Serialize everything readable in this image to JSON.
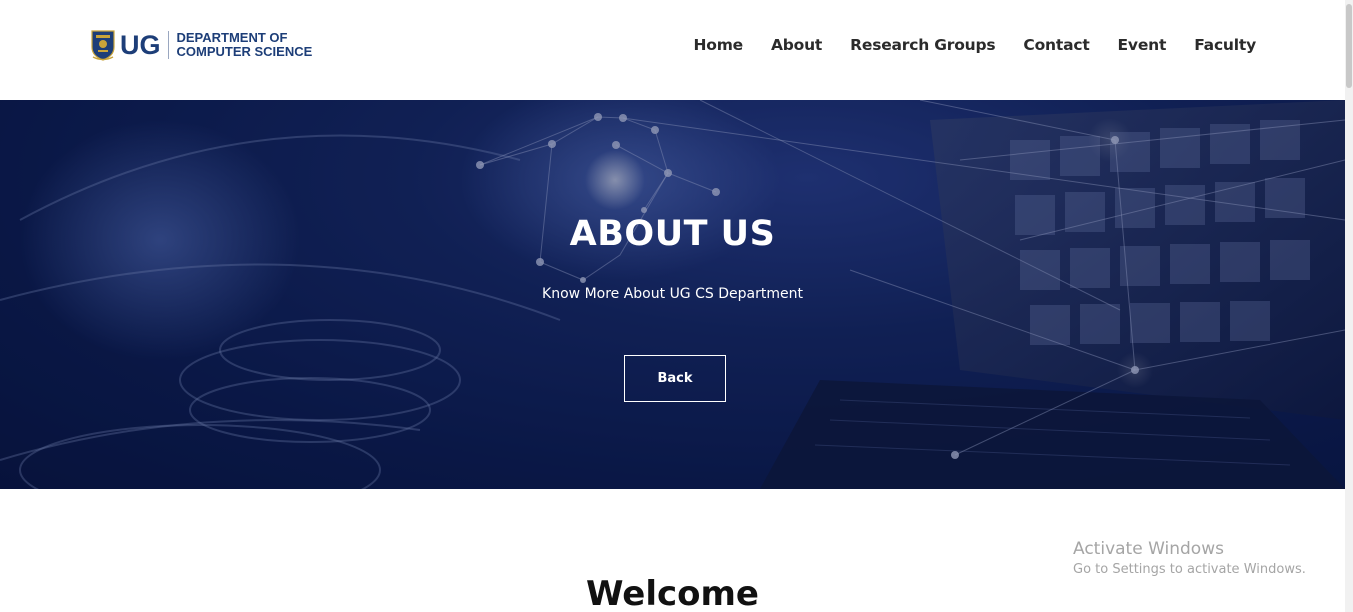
{
  "header": {
    "logo": {
      "abbr": "UG",
      "line1": "DEPARTMENT OF",
      "line2": "COMPUTER SCIENCE"
    },
    "nav": [
      {
        "label": "Home",
        "icon": null
      },
      {
        "label": "About"
      },
      {
        "label": "Research Groups"
      },
      {
        "label": "Contact"
      },
      {
        "label": "Event"
      },
      {
        "label": "Faculty"
      }
    ]
  },
  "hero": {
    "title": "ABOUT US",
    "subtitle": "Know More About UG CS Department",
    "button": "Back"
  },
  "main": {
    "heading": "Welcome"
  },
  "watermark": {
    "title": "Activate Windows",
    "subtitle": "Go to Settings to activate Windows."
  },
  "colors": {
    "brand": "#1d3e78",
    "hero_bg": "#0b1a4a",
    "nav_text": "#2b2b2b"
  }
}
